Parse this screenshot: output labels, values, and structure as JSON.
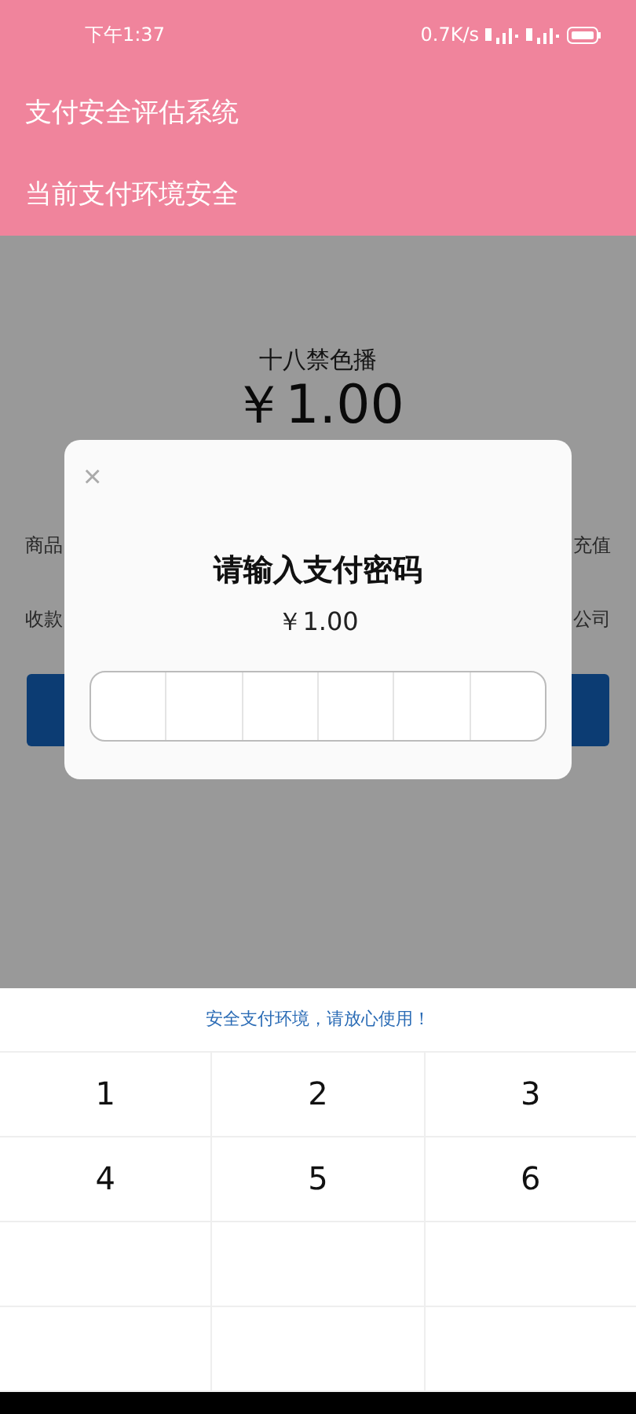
{
  "status_bar": {
    "time": "下午1:37",
    "speed": "0.7K/s"
  },
  "header": {
    "title": "支付安全评估系统",
    "subtitle": "当前支付环境安全"
  },
  "order": {
    "merchant": "十八禁色播",
    "amount": "￥1.00",
    "rows": [
      {
        "label": "商品",
        "value": "充值"
      },
      {
        "label": "收款",
        "value": "公司"
      }
    ]
  },
  "dialog": {
    "close": "×",
    "title": "请输入支付密码",
    "amount": "￥1.00"
  },
  "keypad": {
    "hint": "安全支付环境，请放心使用！",
    "keys": [
      [
        "1",
        "2",
        "3"
      ],
      [
        "4",
        "5",
        "6"
      ]
    ]
  }
}
